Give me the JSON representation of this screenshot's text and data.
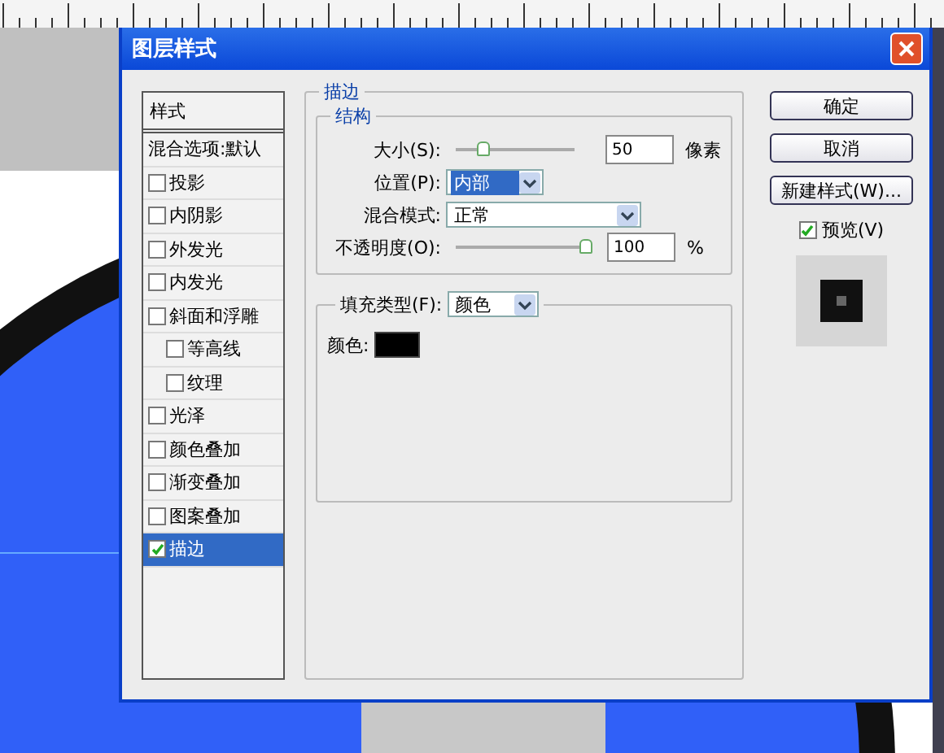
{
  "window": {
    "title": "图层样式"
  },
  "styles_list": {
    "header": "样式",
    "items": [
      {
        "label": "混合选项:默认",
        "kind": "plain",
        "selected": false
      },
      {
        "label": "投影",
        "kind": "check",
        "checked": false,
        "selected": false
      },
      {
        "label": "内阴影",
        "kind": "check",
        "checked": false,
        "selected": false
      },
      {
        "label": "外发光",
        "kind": "check",
        "checked": false,
        "selected": false
      },
      {
        "label": "内发光",
        "kind": "check",
        "checked": false,
        "selected": false
      },
      {
        "label": "斜面和浮雕",
        "kind": "check",
        "checked": false,
        "selected": false,
        "children": [
          {
            "label": "等高线",
            "kind": "check",
            "checked": false,
            "selected": false
          },
          {
            "label": "纹理",
            "kind": "check",
            "checked": false,
            "selected": false
          }
        ]
      },
      {
        "label": "光泽",
        "kind": "check",
        "checked": false,
        "selected": false
      },
      {
        "label": "颜色叠加",
        "kind": "check",
        "checked": false,
        "selected": false
      },
      {
        "label": "渐变叠加",
        "kind": "check",
        "checked": false,
        "selected": false
      },
      {
        "label": "图案叠加",
        "kind": "check",
        "checked": false,
        "selected": false
      },
      {
        "label": "描边",
        "kind": "check",
        "checked": true,
        "selected": true
      }
    ]
  },
  "stroke": {
    "title": "描边",
    "structure": {
      "title": "结构",
      "size": {
        "label": "大小(S):",
        "level": 0.25,
        "value": "50",
        "unit": "像素"
      },
      "position": {
        "label": "位置(P):",
        "value": "内部",
        "focused": true
      },
      "blend_mode": {
        "label": "混合模式:",
        "value": "正常",
        "focused": false
      },
      "opacity": {
        "label": "不透明度(O):",
        "level": 1.0,
        "value": "100",
        "unit": "%"
      }
    },
    "fill": {
      "label": "填充类型(F):",
      "value": "颜色",
      "color_label": "颜色:",
      "color": "#000000"
    }
  },
  "buttons": [
    "确定",
    "取消",
    "新建样式(W)..."
  ],
  "preview": {
    "label": "预览(V)",
    "checked": true
  }
}
